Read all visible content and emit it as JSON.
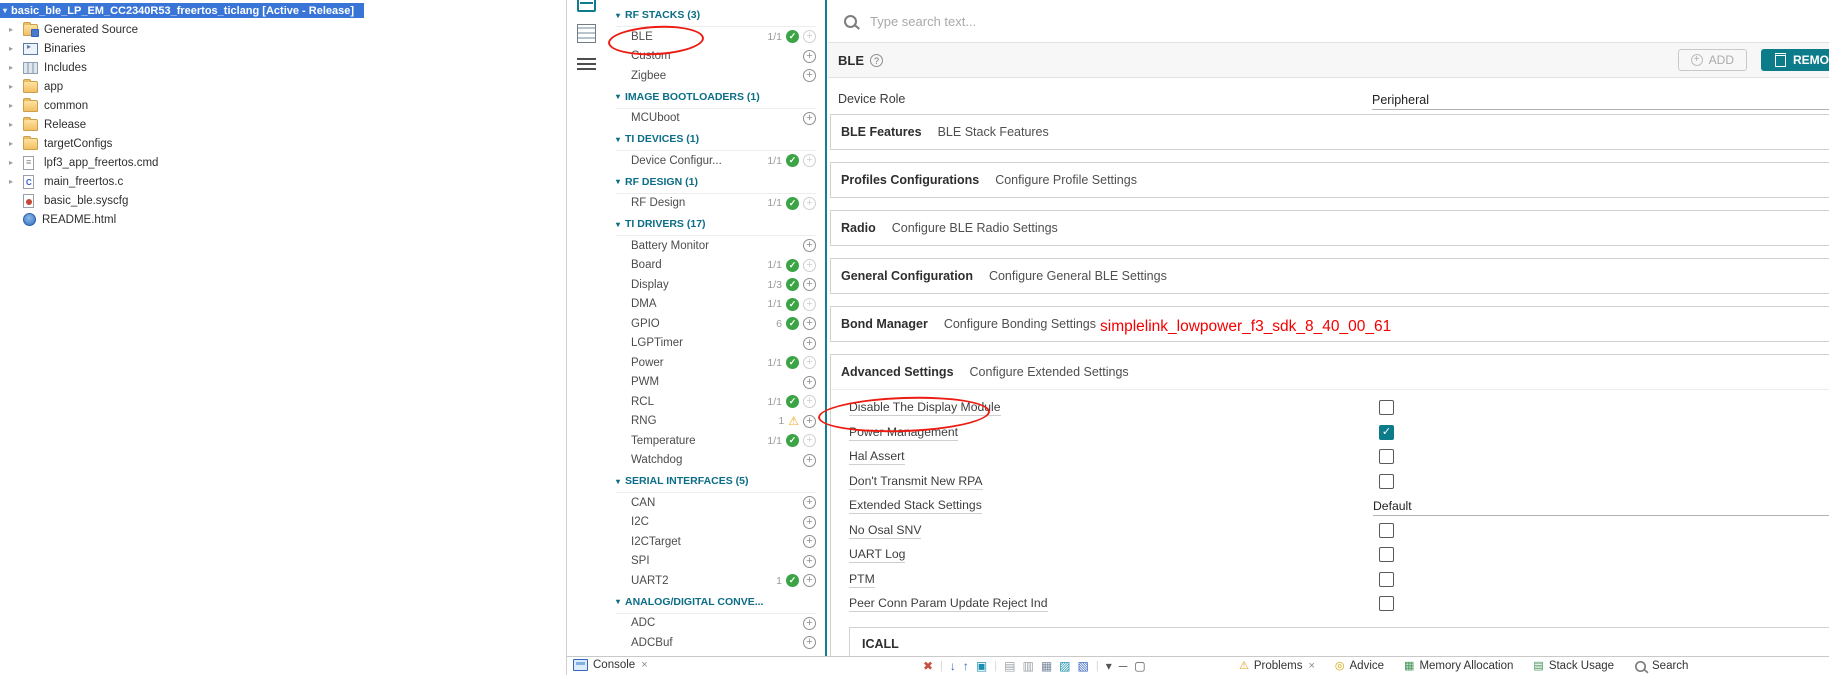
{
  "colors": {
    "accent_teal": "#0d7c8a",
    "status_green": "#3ba445",
    "warning_orange": "#f0a41c",
    "selection_blue": "#3875d7",
    "annotation_red": "#ec1c12"
  },
  "explorer": {
    "active_project": "basic_ble_LP_EM_CC2340R53_freertos_ticlang  [Active - Release]",
    "items": [
      {
        "label": "Generated Source",
        "icon": "source-folder-icon",
        "expandable": true
      },
      {
        "label": "Binaries",
        "icon": "binaries-icon",
        "expandable": true
      },
      {
        "label": "Includes",
        "icon": "includes-icon",
        "expandable": true
      },
      {
        "label": "app",
        "icon": "folder-icon",
        "expandable": true
      },
      {
        "label": "common",
        "icon": "folder-icon",
        "expandable": true
      },
      {
        "label": "Release",
        "icon": "folder-icon",
        "expandable": true
      },
      {
        "label": "targetConfigs",
        "icon": "folder-icon",
        "expandable": true
      },
      {
        "label": "lpf3_app_freertos.cmd",
        "icon": "cmd-file-icon",
        "expandable": true
      },
      {
        "label": "main_freertos.c",
        "icon": "c-file-icon",
        "expandable": true
      },
      {
        "label": "basic_ble.syscfg",
        "icon": "syscfg-file-icon",
        "expandable": false
      },
      {
        "label": "README.html",
        "icon": "html-file-icon",
        "expandable": false
      }
    ]
  },
  "tree": {
    "groups": [
      {
        "label": "RF STACKS (3)",
        "items": [
          {
            "label": "BLE",
            "count": "1/1",
            "status": "ok"
          },
          {
            "label": "Custom"
          },
          {
            "label": "Zigbee"
          }
        ]
      },
      {
        "label": "IMAGE BOOTLOADERS (1)",
        "items": [
          {
            "label": "MCUboot"
          }
        ]
      },
      {
        "label": "TI DEVICES (1)",
        "items": [
          {
            "label": "Device Configur...",
            "count": "1/1",
            "status": "ok"
          }
        ]
      },
      {
        "label": "RF DESIGN (1)",
        "items": [
          {
            "label": "RF Design",
            "count": "1/1",
            "status": "ok"
          }
        ]
      },
      {
        "label": "TI DRIVERS (17)",
        "items": [
          {
            "label": "Battery Monitor"
          },
          {
            "label": "Board",
            "count": "1/1",
            "status": "ok"
          },
          {
            "label": "Display",
            "count": "1/3",
            "status": "ok"
          },
          {
            "label": "DMA",
            "count": "1/1",
            "status": "ok"
          },
          {
            "label": "GPIO",
            "count": "6",
            "status": "ok"
          },
          {
            "label": "LGPTimer"
          },
          {
            "label": "Power",
            "count": "1/1",
            "status": "ok"
          },
          {
            "label": "PWM"
          },
          {
            "label": "RCL",
            "count": "1/1",
            "status": "ok"
          },
          {
            "label": "RNG",
            "count": "1",
            "status": "warn"
          },
          {
            "label": "Temperature",
            "count": "1/1",
            "status": "ok"
          },
          {
            "label": "Watchdog"
          }
        ]
      },
      {
        "label": "SERIAL INTERFACES (5)",
        "items": [
          {
            "label": "CAN"
          },
          {
            "label": "I2C"
          },
          {
            "label": "I2CTarget"
          },
          {
            "label": "SPI"
          },
          {
            "label": "UART2",
            "count": "1",
            "status": "ok"
          }
        ]
      },
      {
        "label": "ANALOG/DIGITAL CONVE...",
        "items": [
          {
            "label": "ADC"
          },
          {
            "label": "ADCBuf"
          }
        ]
      }
    ]
  },
  "panel": {
    "search": {
      "placeholder": "Type search text..."
    },
    "module": {
      "title": "BLE",
      "info_glyph": "?",
      "add_label": "ADD",
      "remove_label": "REMOVE"
    },
    "device_role": {
      "label": "Device Role",
      "value": "Peripheral"
    },
    "sections": [
      {
        "title": "BLE Features",
        "subtitle": "BLE Stack Features"
      },
      {
        "title": "Profiles Configurations",
        "subtitle": "Configure Profile Settings"
      },
      {
        "title": "Radio",
        "subtitle": "Configure BLE Radio Settings"
      },
      {
        "title": "General Configuration",
        "subtitle": "Configure General BLE Settings"
      },
      {
        "title": "Bond Manager",
        "subtitle": "Configure Bonding Settings"
      }
    ],
    "advanced": {
      "title": "Advanced Settings",
      "subtitle": "Configure Extended Settings",
      "rows": [
        {
          "label": "Disable The Display Module",
          "control": "checkbox",
          "checked": false
        },
        {
          "label": "Power Management",
          "control": "checkbox",
          "checked": true
        },
        {
          "label": "Hal Assert",
          "control": "checkbox",
          "checked": false
        },
        {
          "label": "Don't Transmit New RPA",
          "control": "checkbox",
          "checked": false
        },
        {
          "label": "Extended Stack Settings",
          "control": "select",
          "value": "Default"
        },
        {
          "label": "No Osal SNV",
          "control": "checkbox",
          "checked": false
        },
        {
          "label": "UART Log",
          "control": "checkbox",
          "checked": false
        },
        {
          "label": "PTM",
          "control": "checkbox",
          "checked": false
        },
        {
          "label": "Peer Conn Param Update Reject Ind",
          "control": "checkbox",
          "checked": false
        }
      ],
      "subsection": {
        "title": "ICALL"
      }
    }
  },
  "bottom": {
    "console_tab": {
      "label": "Console",
      "close": "×"
    },
    "toolbar_icons": [
      "clear-console-icon",
      "scroll-down-icon",
      "scroll-up-icon",
      "show-console-icon",
      "scroll-lock-icon",
      "word-wrap-icon",
      "clear-view-icon",
      "display-console-icon",
      "pin-console-icon",
      "open-console-icon",
      "minimize-icon",
      "maximize-icon"
    ],
    "tabs": [
      {
        "label": "Problems",
        "icon": "problems-icon",
        "close": "×"
      },
      {
        "label": "Advice",
        "icon": "advice-icon"
      },
      {
        "label": "Memory Allocation",
        "icon": "memory-allocation-icon"
      },
      {
        "label": "Stack Usage",
        "icon": "stack-usage-icon"
      },
      {
        "label": "Search",
        "icon": "search-icon"
      }
    ]
  },
  "annotations": {
    "sdk_text": "simplelink_lowpower_f3_sdk_8_40_00_61"
  }
}
